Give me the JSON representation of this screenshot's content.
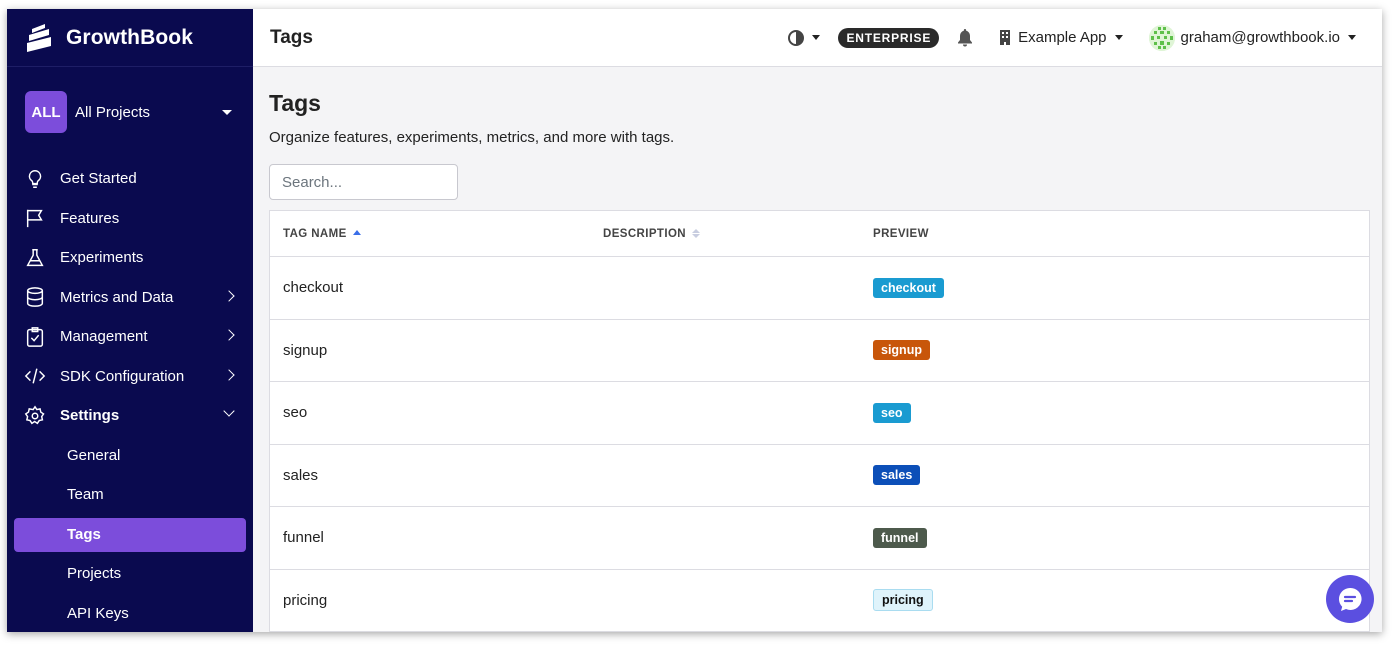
{
  "brand": {
    "name": "GrowthBook"
  },
  "project": {
    "badge": "ALL",
    "name": "All Projects"
  },
  "nav": [
    {
      "label": "Get Started",
      "icon": "lightbulb-icon"
    },
    {
      "label": "Features",
      "icon": "flag-icon"
    },
    {
      "label": "Experiments",
      "icon": "flask-icon"
    },
    {
      "label": "Metrics and Data",
      "icon": "database-icon"
    },
    {
      "label": "Management",
      "icon": "clipboard-icon"
    },
    {
      "label": "SDK Configuration",
      "icon": "code-icon"
    },
    {
      "label": "Settings",
      "icon": "gear-icon"
    }
  ],
  "settings_sub": [
    "General",
    "Team",
    "Tags",
    "Projects",
    "API Keys"
  ],
  "topbar": {
    "title": "Tags",
    "badge": "ENTERPRISE",
    "org": "Example App",
    "user": "graham@growthbook.io"
  },
  "page": {
    "heading": "Tags",
    "description": "Organize features, experiments, metrics, and more with tags.",
    "search_placeholder": "Search..."
  },
  "table": {
    "headers": [
      "TAG NAME",
      "DESCRIPTION",
      "PREVIEW"
    ],
    "rows": [
      {
        "name": "checkout",
        "description": "",
        "tag": "checkout",
        "color": "#1a9bd1",
        "text": "#ffffff"
      },
      {
        "name": "signup",
        "description": "",
        "tag": "signup",
        "color": "#c8560a",
        "text": "#ffffff"
      },
      {
        "name": "seo",
        "description": "",
        "tag": "seo",
        "color": "#1a9bd1",
        "text": "#ffffff"
      },
      {
        "name": "sales",
        "description": "",
        "tag": "sales",
        "color": "#0c4fb8",
        "text": "#ffffff"
      },
      {
        "name": "funnel",
        "description": "",
        "tag": "funnel",
        "color": "#4d5a4c",
        "text": "#ffffff"
      },
      {
        "name": "pricing",
        "description": "",
        "tag": "pricing",
        "color": "#dff3fb",
        "text": "#111111"
      }
    ]
  },
  "colors": {
    "sidebar": "#0a0a4f",
    "accent": "#7c4ddb",
    "chat": "#5b4fe0"
  }
}
